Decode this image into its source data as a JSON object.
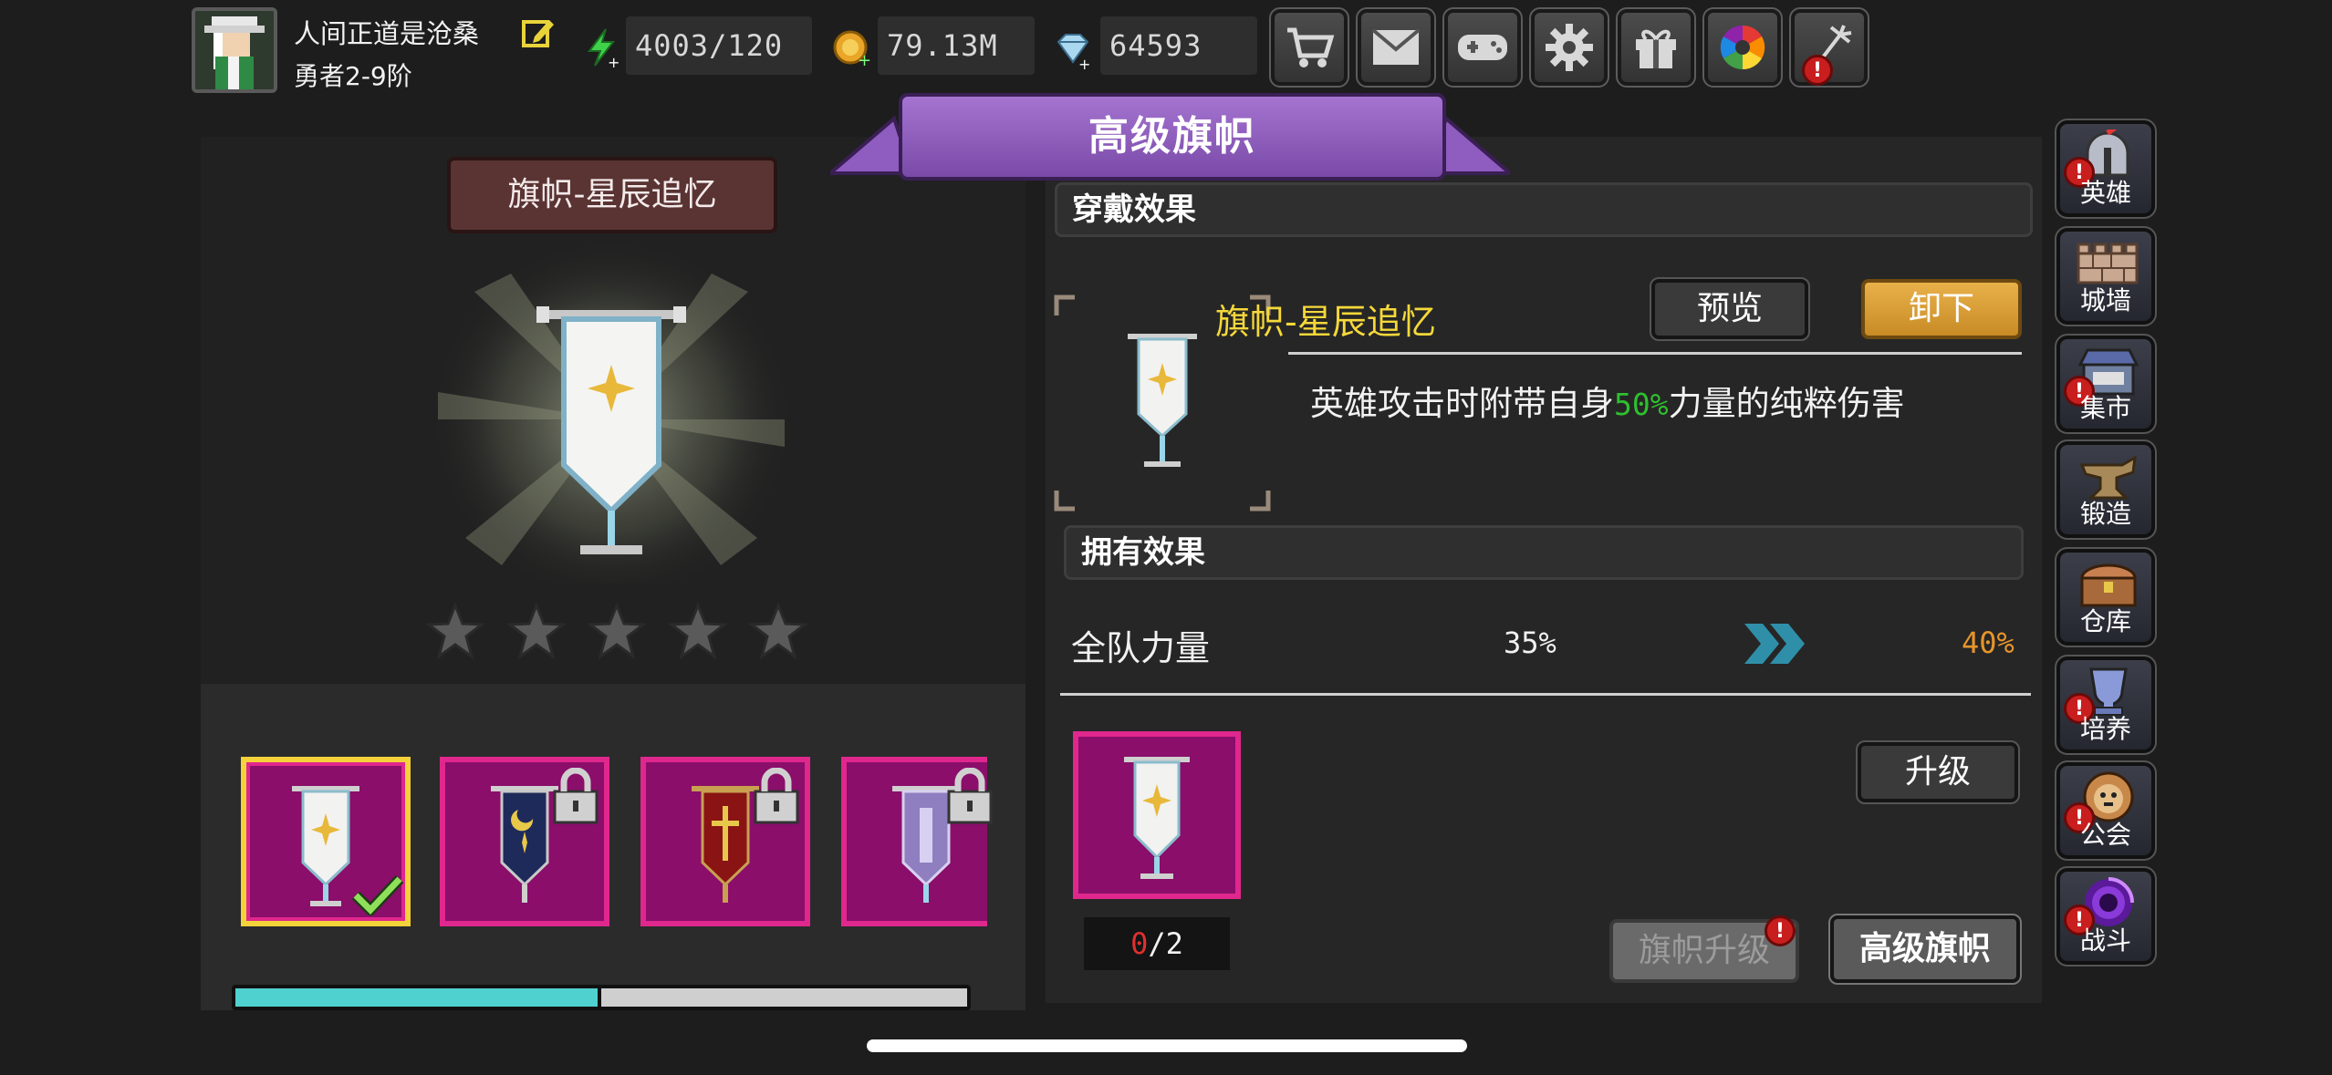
{
  "player": {
    "name": "人间正道是沧桑",
    "rank": "勇者2-9阶"
  },
  "resources": {
    "energy": "4003/120",
    "gold": "79.13M",
    "gems": "64593"
  },
  "top_buttons": [
    "cart-icon",
    "mail-icon",
    "gamepad-icon",
    "gear-icon",
    "gift-icon",
    "color-wheel-icon",
    "firework-icon"
  ],
  "window": {
    "title": "高级旗帜"
  },
  "item": {
    "plate_name": "旗帜-星辰追忆",
    "name": "旗帜-星辰追忆",
    "stars_total": 5,
    "stars_filled": 0
  },
  "equip_effect": {
    "header": "穿戴效果",
    "desc_before": "英雄攻击时附带自身",
    "desc_highlight": "50%",
    "desc_after": "力量的纯粹伤害"
  },
  "buttons": {
    "preview": "预览",
    "unequip": "卸下",
    "upgrade": "升级",
    "banner_upgrade": "旗帜升级",
    "advanced_banner": "高级旗帜"
  },
  "own_effect": {
    "header": "拥有效果",
    "stat_name": "全队力量",
    "current": "35%",
    "next": "40%"
  },
  "material": {
    "have": "0",
    "sep_need": "/2"
  },
  "collection_progress": 0.5,
  "sidebar": [
    {
      "label": "英雄",
      "icon": "helmet-icon",
      "alert": true
    },
    {
      "label": "城墙",
      "icon": "wall-icon",
      "alert": false
    },
    {
      "label": "集市",
      "icon": "market-icon",
      "alert": true
    },
    {
      "label": "锻造",
      "icon": "anvil-icon",
      "alert": false
    },
    {
      "label": "仓库",
      "icon": "chest-icon",
      "alert": false
    },
    {
      "label": "培养",
      "icon": "trophy-icon",
      "alert": true
    },
    {
      "label": "公会",
      "icon": "lion-icon",
      "alert": true
    },
    {
      "label": "战斗",
      "icon": "portal-icon",
      "alert": true
    }
  ],
  "colors": {
    "accent_purple": "#8f5cc0",
    "slot_magenta": "#8a0e6a",
    "name_yellow": "#f5d83a",
    "highlight_green": "#2fbf2f",
    "next_orange": "#e8952a",
    "progress_teal": "#4fd1cf"
  }
}
